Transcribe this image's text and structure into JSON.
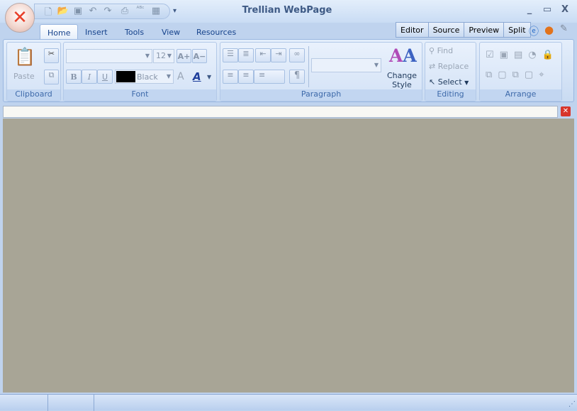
{
  "window": {
    "title": "Trellian WebPage",
    "minimize": "_",
    "maximize": "▭",
    "close": "X"
  },
  "qat": [
    "new-icon",
    "open-icon",
    "save-icon",
    "undo-icon",
    "redo-icon",
    "print-icon",
    "spellcheck-icon",
    "table-icon"
  ],
  "tabs": [
    {
      "label": "Home",
      "active": true
    },
    {
      "label": "Insert"
    },
    {
      "label": "Tools"
    },
    {
      "label": "View"
    },
    {
      "label": "Resources"
    }
  ],
  "modes": [
    "Editor",
    "Source",
    "Preview",
    "Split"
  ],
  "clipboard": {
    "paste": "Paste",
    "label": "Clipboard"
  },
  "font": {
    "family": "",
    "size": "12",
    "color_name": "Black",
    "color": "#000000",
    "grow": "A+",
    "shrink": "A−",
    "bold": "B",
    "italic": "I",
    "underline": "U",
    "label": "Font"
  },
  "paragraph": {
    "style": "",
    "change_style": "Change Style",
    "label": "Paragraph",
    "pilcrow": "¶"
  },
  "editing": {
    "find": "Find",
    "replace": "Replace",
    "select": "Select",
    "label": "Editing"
  },
  "arrange": {
    "label": "Arrange"
  },
  "address": {
    "value": ""
  },
  "colors": {
    "editor_bg": "#a8a596",
    "accent": "#15428b"
  }
}
